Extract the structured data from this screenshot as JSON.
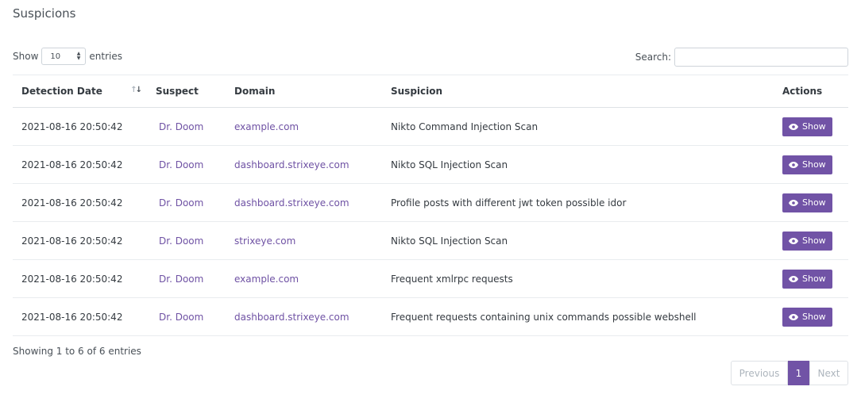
{
  "page": {
    "title": "Suspicions"
  },
  "length": {
    "show_label": "Show",
    "value": "10",
    "entries_label": "entries"
  },
  "search": {
    "label": "Search:",
    "value": ""
  },
  "table": {
    "headers": [
      "Detection Date",
      "Suspect",
      "Domain",
      "Suspicion",
      "Actions"
    ],
    "rows": [
      {
        "date": "2021-08-16 20:50:42",
        "suspect": "Dr. Doom",
        "domain": "example.com",
        "suspicion": "Nikto Command Injection Scan",
        "action": "Show"
      },
      {
        "date": "2021-08-16 20:50:42",
        "suspect": "Dr. Doom",
        "domain": "dashboard.strixeye.com",
        "suspicion": "Nikto SQL Injection Scan",
        "action": "Show"
      },
      {
        "date": "2021-08-16 20:50:42",
        "suspect": "Dr. Doom",
        "domain": "dashboard.strixeye.com",
        "suspicion": "Profile posts with different jwt token possible idor",
        "action": "Show"
      },
      {
        "date": "2021-08-16 20:50:42",
        "suspect": "Dr. Doom",
        "domain": "strixeye.com",
        "suspicion": "Nikto SQL Injection Scan",
        "action": "Show"
      },
      {
        "date": "2021-08-16 20:50:42",
        "suspect": "Dr. Doom",
        "domain": "example.com",
        "suspicion": "Frequent xmlrpc requests",
        "action": "Show"
      },
      {
        "date": "2021-08-16 20:50:42",
        "suspect": "Dr. Doom",
        "domain": "dashboard.strixeye.com",
        "suspicion": "Frequent requests containing unix commands possible webshell",
        "action": "Show"
      }
    ]
  },
  "info": "Showing 1 to 6 of 6 entries",
  "pagination": {
    "previous": "Previous",
    "current": "1",
    "next": "Next"
  },
  "colors": {
    "accent": "#7153a6",
    "link": "#6f52a4"
  }
}
